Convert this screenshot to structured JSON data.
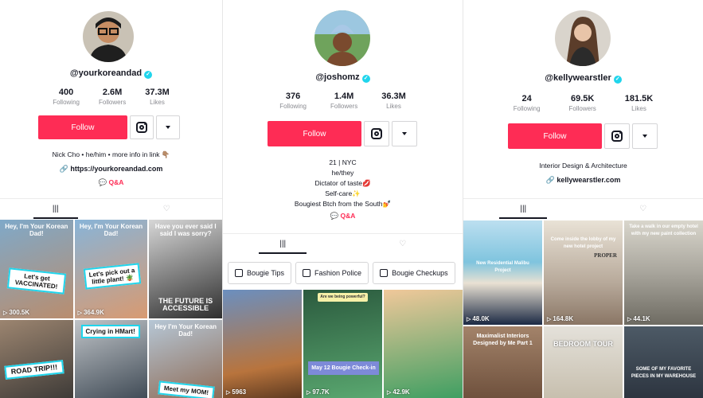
{
  "colors": {
    "accent": "#fe2c55",
    "verified": "#20d5ec"
  },
  "profiles": [
    {
      "handle": "@yourkoreandad",
      "following": "400",
      "followers": "2.6M",
      "likes": "37.3M",
      "labels": {
        "following": "Following",
        "followers": "Followers",
        "likes": "Likes"
      },
      "follow": "Follow",
      "bio": [
        "Nick Cho • he/him •  more info in link 👇🏽"
      ],
      "link": "https://yourkoreandad.com",
      "qa": "Q&A",
      "videos": [
        {
          "caption": "Hey, I'm Your Korean Dad!",
          "sticker": "Let's get VACCINATED!",
          "views": "300.5K"
        },
        {
          "caption": "Hey, I'm Your Korean Dad!",
          "sticker": "Let's pick out a little plant! 🪴",
          "views": "364.9K"
        },
        {
          "caption": "Have you ever said I said I was sorry?",
          "sticker": "THE FUTURE IS ACCESSIBLE",
          "views": ""
        },
        {
          "caption": "",
          "sticker": "ROAD TRIP!!!",
          "views": ""
        },
        {
          "caption": "",
          "sticker": "Crying in HMart!",
          "views": ""
        },
        {
          "caption": "Hey I'm Your Korean Dad!",
          "sticker": "Meet my MOM!",
          "views": ""
        }
      ]
    },
    {
      "handle": "@joshomz",
      "following": "376",
      "followers": "1.4M",
      "likes": "36.3M",
      "labels": {
        "following": "Following",
        "followers": "Followers",
        "likes": "Likes"
      },
      "follow": "Follow",
      "bio": [
        "21 | NYC",
        "he/they",
        "Dictator of taste💋",
        "Self-care✨",
        "Bougiest Btch from the South💅"
      ],
      "qa": "Q&A",
      "playlists": [
        "Bougie Tips",
        "Fashion Police",
        "Bougie Checkups"
      ],
      "videos": [
        {
          "caption": "",
          "sticker": "",
          "views": "5963"
        },
        {
          "caption": "Are we being powerful?",
          "sticker": "May 12 Bougie Check-in",
          "views": "97.7K"
        },
        {
          "caption": "",
          "sticker": "",
          "views": "42.9K"
        }
      ]
    },
    {
      "handle": "@kellywearstler",
      "following": "24",
      "followers": "69.5K",
      "likes": "181.5K",
      "labels": {
        "following": "Following",
        "followers": "Followers",
        "likes": "Likes"
      },
      "follow": "Follow",
      "bio": [
        "Interior Design & Architecture"
      ],
      "link": "kellywearstler.com",
      "videos": [
        {
          "caption": "New Residential Malibu Project",
          "sticker": "",
          "views": "48.0K"
        },
        {
          "caption": "Come inside the lobby of my new hotel project",
          "sticker": "PROPER",
          "views": "164.8K"
        },
        {
          "caption": "Take a walk in our empty hotel with my new paint collection",
          "sticker": "",
          "views": "44.1K"
        },
        {
          "caption": "Maximalist Interiors Designed by Me Part 1",
          "sticker": "",
          "views": ""
        },
        {
          "caption": "BEDROOM TOUR",
          "sticker": "",
          "views": ""
        },
        {
          "caption": "SOME OF MY FAVORITE PIECES IN MY WAREHOUSE",
          "sticker": "",
          "views": ""
        }
      ]
    }
  ]
}
